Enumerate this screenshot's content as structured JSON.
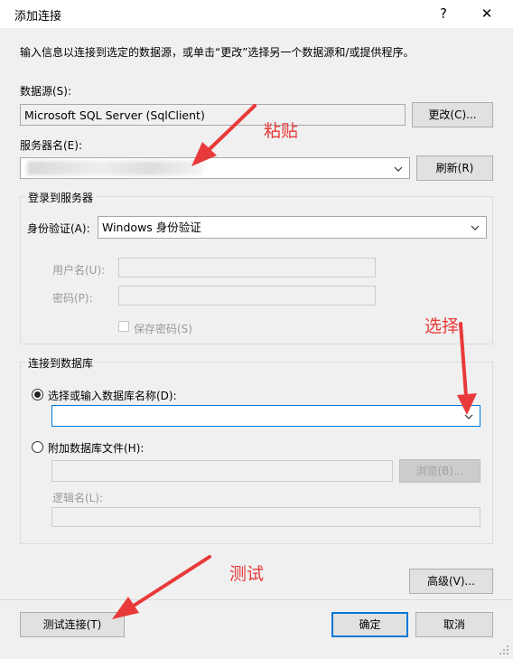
{
  "window": {
    "title": "添加连接",
    "help_icon": "?",
    "close_icon": "✕"
  },
  "description": "输入信息以连接到选定的数据源，或单击“更改”选择另一个数据源和/或提供程序。",
  "datasource": {
    "label": "数据源(S):",
    "value": "Microsoft SQL Server (SqlClient)",
    "change_button": "更改(C)..."
  },
  "server": {
    "label": "服务器名(E):",
    "value": "",
    "refresh_button": "刷新(R)"
  },
  "login_group": {
    "title": "登录到服务器",
    "auth_label": "身份验证(A):",
    "auth_value": "Windows 身份验证",
    "username_label": "用户名(U):",
    "password_label": "密码(P):",
    "save_password_label": "保存密码(S)"
  },
  "db_group": {
    "title": "连接到数据库",
    "select_db_label": "选择或输入数据库名称(D):",
    "select_db_value": "",
    "attach_label": "附加数据库文件(H):",
    "browse_button": "浏览(B)...",
    "logical_name_label": "逻辑名(L):"
  },
  "advanced_button": "高级(V)...",
  "test_button": "测试连接(T)",
  "ok_button": "确定",
  "cancel_button": "取消",
  "annotations": {
    "paste": "粘贴",
    "select": "选择",
    "test": "测试"
  },
  "colors": {
    "annotation": "#e83a3a",
    "focus_border": "#0078d7"
  }
}
